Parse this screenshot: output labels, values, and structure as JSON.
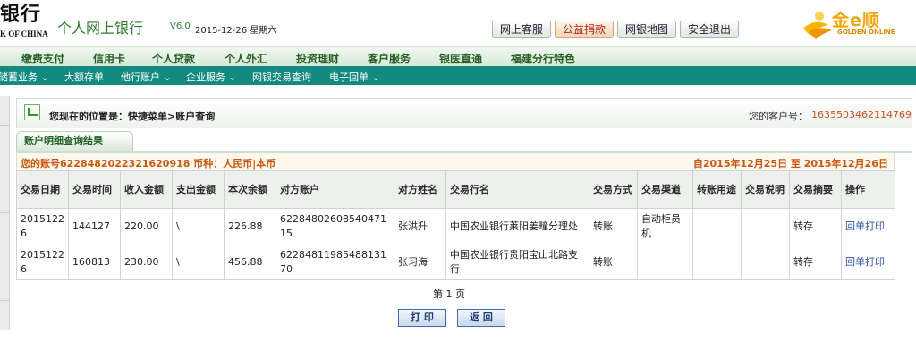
{
  "header": {
    "bank_name": "银行",
    "bank_en": "K OF CHINA",
    "product_title": "个人网上银行",
    "version": "V6.0",
    "date": "2015-12-26 星期六",
    "buttons": [
      "网上客服",
      "公益捐款",
      "网银地图",
      "安全退出"
    ],
    "golden_logo": "金e顺",
    "golden_sub": "GOLDEN ONLINE"
  },
  "nav1": [
    "缴费支付",
    "信用卡",
    "个人贷款",
    "个人外汇",
    "投资理财",
    "客户服务",
    "银医直通",
    "福建分行特色"
  ],
  "nav2": [
    "储蓄业务 ⌄",
    "大额存单",
    "他行账户 ⌄",
    "企业服务 ⌄",
    "网银交易查询",
    "电子回单 ⌄"
  ],
  "breadcrumb": {
    "text": "您现在的位置是：快捷菜单>账户查询",
    "customer_label": "您的客户号：",
    "customer_no": "1635503462114769"
  },
  "tab": {
    "label": "账户明细查询结果"
  },
  "account": {
    "left": "您的账号6228482022321620918 币种：人民币|本币",
    "right": "自2015年12月25日  至  2015年12月26日"
  },
  "table": {
    "headers": [
      "交易日期",
      "交易时间",
      "收入金额",
      "支出金额",
      "本次余额",
      "对方账户",
      "对方姓名",
      "交易行名",
      "交易方式",
      "交易渠道",
      "转账用途",
      "交易说明",
      "交易摘要",
      "操作"
    ],
    "rows": [
      [
        "20151226",
        "144127",
        "220.00",
        "\\",
        "226.88",
        "6228480260854047115",
        "张洪升",
        "中国农业银行莱阳姜疃分理处",
        "转账",
        "自动柜员机",
        "",
        "",
        "转存",
        "回单打印"
      ],
      [
        "20151226",
        "160813",
        "230.00",
        "\\",
        "456.88",
        "6228481198548813170",
        "张习海",
        "中国农业银行贵阳宝山北路支行",
        "转账",
        "",
        "",
        "",
        "转存",
        "回单打印"
      ]
    ]
  },
  "pagination": {
    "text": "第 1 页"
  },
  "actions": {
    "print": "打 印",
    "back": "返 回"
  },
  "colors": {
    "nav_teal": "#138a80",
    "accent_orange": "#c85710",
    "brand_green": "#2d7c2d"
  }
}
